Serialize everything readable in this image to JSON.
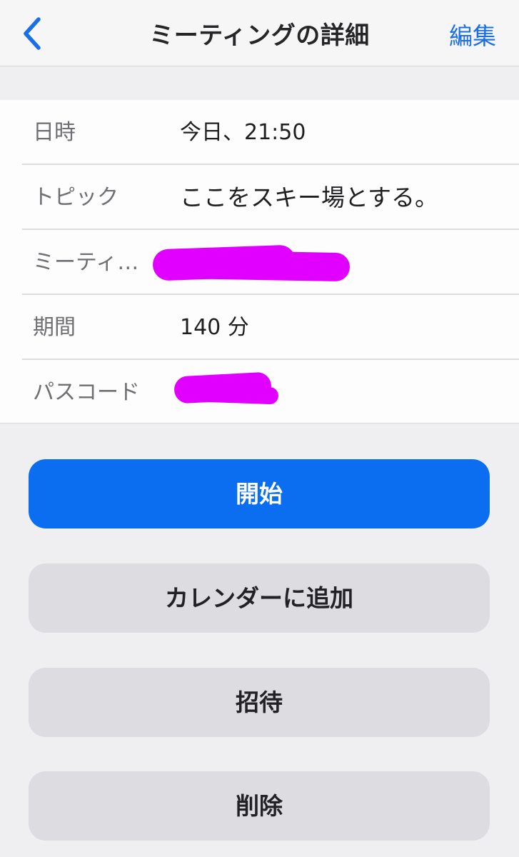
{
  "header": {
    "title": "ミーティングの詳細",
    "edit_label": "編集",
    "back_icon": "chevron-left-icon",
    "accent_color": "#1a6ee8"
  },
  "details": {
    "rows": [
      {
        "label": "日時",
        "value": "今日、21:50"
      },
      {
        "label": "トピック",
        "value": "ここをスキー場とする。"
      },
      {
        "label": "ミーティ…",
        "value": ""
      },
      {
        "label": "期間",
        "value": "140 分"
      },
      {
        "label": "パスコード",
        "value": ""
      }
    ]
  },
  "actions": {
    "start_label": "開始",
    "add_calendar_label": "カレンダーに追加",
    "invite_label": "招待",
    "delete_label": "削除",
    "primary_color": "#0b6ef0"
  }
}
